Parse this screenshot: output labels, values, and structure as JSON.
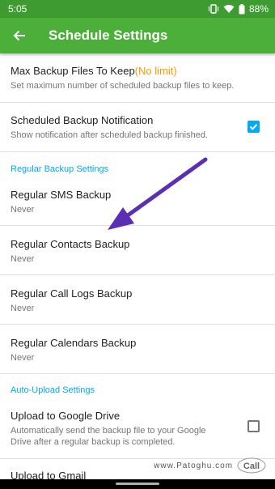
{
  "status_bar": {
    "time": "5:05",
    "battery": "88%"
  },
  "app_bar": {
    "title": "Schedule Settings"
  },
  "prefs": [
    {
      "title": "Max Backup Files To Keep",
      "highlight": "(No limit)",
      "summary": "Set maximum number of scheduled backup files to keep."
    },
    {
      "title": "Scheduled Backup Notification",
      "summary": "Show notification after scheduled backup finished.",
      "checked": true
    }
  ],
  "sections": {
    "regular": "Regular Backup Settings",
    "upload": "Auto-Upload Settings"
  },
  "regular_items": [
    {
      "title": "Regular SMS Backup",
      "summary": "Never"
    },
    {
      "title": "Regular Contacts Backup",
      "summary": "Never"
    },
    {
      "title": "Regular Call Logs Backup",
      "summary": "Never"
    },
    {
      "title": "Regular Calendars Backup",
      "summary": "Never"
    }
  ],
  "upload_items": [
    {
      "title": "Upload to Google Drive",
      "summary": "Automatically send the backup file to your Google Drive after a regular backup is completed.",
      "checked": false
    },
    {
      "title": "Upload to Gmail"
    }
  ],
  "watermark": {
    "text": "www.Patoghu.com",
    "logo_text": "Call"
  },
  "colors": {
    "status_bar": "#3e9b31",
    "app_bar": "#4caf39",
    "accent": "#03a9f4",
    "highlight": "#ff9800",
    "arrow": "#5b2fb2"
  }
}
